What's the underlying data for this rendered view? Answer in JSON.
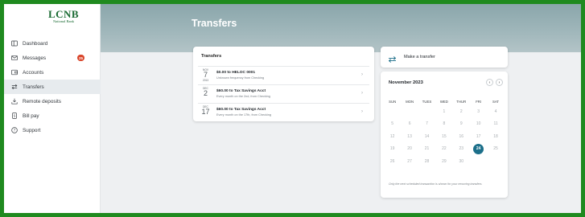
{
  "brand": {
    "name": "LCNB",
    "subtitle": "National Bank",
    "color": "#1a6b33"
  },
  "sidebar": {
    "items": [
      {
        "label": "Dashboard",
        "icon": "dashboard-icon"
      },
      {
        "label": "Messages",
        "icon": "envelope-icon",
        "badge": "25"
      },
      {
        "label": "Accounts",
        "icon": "accounts-icon"
      },
      {
        "label": "Transfers",
        "icon": "transfer-arrows-icon",
        "active": true
      },
      {
        "label": "Remote deposits",
        "icon": "deposit-icon"
      },
      {
        "label": "Bill pay",
        "icon": "bill-icon"
      },
      {
        "label": "Support",
        "icon": "help-circle-icon"
      }
    ]
  },
  "page": {
    "title": "Transfers"
  },
  "transfers": {
    "title": "Transfers",
    "rows": [
      {
        "month": "NOV",
        "day": "7",
        "year": "2013",
        "title": "$0.00 to HELOC 0001",
        "subtitle": "Unknown frequency from Checking"
      },
      {
        "month": "DEC",
        "day": "2",
        "year": "",
        "title": "$60.00 to Tax Savings Acct",
        "subtitle": "Every month on the 2nd, from Checking"
      },
      {
        "month": "DEC",
        "day": "17",
        "year": "",
        "title": "$60.00 to Tax Savings Acct",
        "subtitle": "Every month on the 17th, from Checking"
      }
    ]
  },
  "make_transfer": {
    "label": "Make a transfer",
    "icon": "transfer-arrows-icon"
  },
  "calendar": {
    "title": "November 2023",
    "weekdays": [
      "SUN",
      "MON",
      "TUES",
      "WED",
      "THUR",
      "FRI",
      "SAT"
    ],
    "weeks": [
      [
        "",
        "",
        "",
        "1",
        "2",
        "3",
        "4"
      ],
      [
        "5",
        "6",
        "7",
        "8",
        "9",
        "10",
        "11"
      ],
      [
        "12",
        "13",
        "14",
        "15",
        "16",
        "17",
        "18"
      ],
      [
        "19",
        "20",
        "21",
        "22",
        "23",
        "24",
        "25"
      ],
      [
        "26",
        "27",
        "28",
        "29",
        "30",
        "",
        ""
      ]
    ],
    "selected_day": "24",
    "note": "Only the next scheduled transaction is shown for your recurring transfers.",
    "accent": "#1c6f8a"
  }
}
